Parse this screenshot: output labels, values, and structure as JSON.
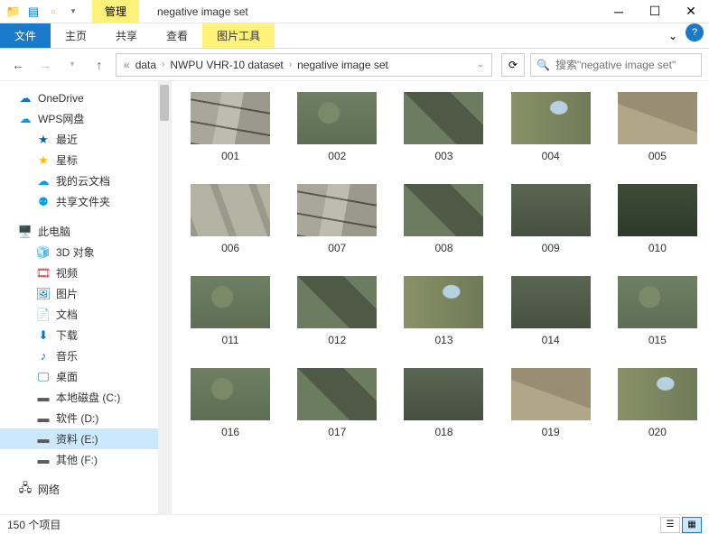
{
  "titlebar": {
    "contextual_tab": "管理",
    "title": "negative image set"
  },
  "ribbon": {
    "file": "文件",
    "home": "主页",
    "share": "共享",
    "view": "查看",
    "picture_tools": "图片工具"
  },
  "nav": {
    "crumbs": [
      "data",
      "NWPU VHR-10 dataset",
      "negative image set"
    ]
  },
  "search": {
    "placeholder": "搜索\"negative image set\""
  },
  "sidebar": {
    "quick": [
      {
        "label": "OneDrive",
        "color": "#0078d4"
      },
      {
        "label": "WPS网盘",
        "color": "#00a0e9"
      },
      {
        "label": "最近",
        "color": "#0a64a4",
        "nested": true,
        "star": "#ffb900"
      },
      {
        "label": "星标",
        "color": "#ffb900",
        "nested": true
      },
      {
        "label": "我的云文档",
        "color": "#00a0e9",
        "nested": true
      },
      {
        "label": "共享文件夹",
        "color": "#00a0e9",
        "nested": true
      }
    ],
    "thispc": {
      "label": "此电脑",
      "color": "#0078d4"
    },
    "pc_items": [
      {
        "label": "3D 对象",
        "color": "#00b7c3"
      },
      {
        "label": "视频",
        "color": "#d13438"
      },
      {
        "label": "图片",
        "color": "#0078d4"
      },
      {
        "label": "文档",
        "color": "#5b5b5b"
      },
      {
        "label": "下载",
        "color": "#0078d4"
      },
      {
        "label": "音乐",
        "color": "#0078d4"
      },
      {
        "label": "桌面",
        "color": "#0078d4"
      },
      {
        "label": "本地磁盘 (C:)",
        "color": "#5b5b5b"
      },
      {
        "label": "软件 (D:)",
        "color": "#5b5b5b"
      },
      {
        "label": "资料 (E:)",
        "color": "#5b5b5b",
        "selected": true
      },
      {
        "label": "其他 (F:)",
        "color": "#5b5b5b"
      }
    ],
    "network": {
      "label": "网络",
      "color": "#0078d4"
    }
  },
  "files": [
    {
      "name": "001",
      "v": "v1"
    },
    {
      "name": "002",
      "v": "v2"
    },
    {
      "name": "003",
      "v": "v3"
    },
    {
      "name": "004",
      "v": "v4"
    },
    {
      "name": "005",
      "v": "v5"
    },
    {
      "name": "006",
      "v": "v6"
    },
    {
      "name": "007",
      "v": "v1"
    },
    {
      "name": "008",
      "v": "v3"
    },
    {
      "name": "009",
      "v": "v7"
    },
    {
      "name": "010",
      "v": "v8"
    },
    {
      "name": "011",
      "v": "v2"
    },
    {
      "name": "012",
      "v": "v3"
    },
    {
      "name": "013",
      "v": "v4"
    },
    {
      "name": "014",
      "v": "v7"
    },
    {
      "name": "015",
      "v": "v2"
    },
    {
      "name": "016",
      "v": "v2"
    },
    {
      "name": "017",
      "v": "v3"
    },
    {
      "name": "018",
      "v": "v7"
    },
    {
      "name": "019",
      "v": "v5"
    },
    {
      "name": "020",
      "v": "v4"
    }
  ],
  "status": {
    "text": "150 个项目"
  }
}
